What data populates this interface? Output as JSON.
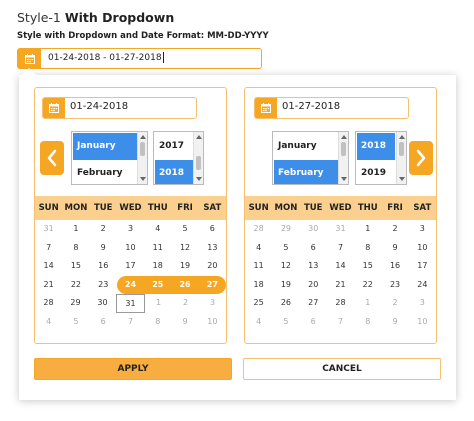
{
  "header": {
    "title_prefix": "Style-1",
    "title_bold": "With Dropdown",
    "subtitle": "Style with Dropdown and Date Format: MM-DD-YYYY"
  },
  "main_input": {
    "value": "01-24-2018 - 01-27-2018"
  },
  "left": {
    "date_value": "01-24-2018",
    "months": [
      {
        "label": "January",
        "selected": true
      },
      {
        "label": "February",
        "selected": false
      }
    ],
    "years": [
      {
        "label": "2017",
        "selected": false
      },
      {
        "label": "2018",
        "selected": true
      }
    ],
    "weekdays": [
      "SUN",
      "MON",
      "TUE",
      "WED",
      "THU",
      "FRI",
      "SAT"
    ],
    "weeks": [
      [
        {
          "d": "31",
          "s": "out"
        },
        {
          "d": "1"
        },
        {
          "d": "2"
        },
        {
          "d": "3"
        },
        {
          "d": "4"
        },
        {
          "d": "5"
        },
        {
          "d": "6"
        }
      ],
      [
        {
          "d": "7"
        },
        {
          "d": "8"
        },
        {
          "d": "9"
        },
        {
          "d": "10"
        },
        {
          "d": "11"
        },
        {
          "d": "12"
        },
        {
          "d": "13"
        }
      ],
      [
        {
          "d": "14"
        },
        {
          "d": "15"
        },
        {
          "d": "16"
        },
        {
          "d": "17"
        },
        {
          "d": "18"
        },
        {
          "d": "19"
        },
        {
          "d": "20"
        }
      ],
      [
        {
          "d": "21"
        },
        {
          "d": "22"
        },
        {
          "d": "23"
        },
        {
          "d": "24",
          "s": "range start"
        },
        {
          "d": "25",
          "s": "range"
        },
        {
          "d": "26",
          "s": "range"
        },
        {
          "d": "27",
          "s": "range end"
        }
      ],
      [
        {
          "d": "28"
        },
        {
          "d": "29"
        },
        {
          "d": "30"
        },
        {
          "d": "31",
          "s": "today"
        },
        {
          "d": "1",
          "s": "out"
        },
        {
          "d": "2",
          "s": "out"
        },
        {
          "d": "3",
          "s": "out"
        }
      ],
      [
        {
          "d": "4",
          "s": "out"
        },
        {
          "d": "5",
          "s": "out"
        },
        {
          "d": "6",
          "s": "out"
        },
        {
          "d": "7",
          "s": "out"
        },
        {
          "d": "8",
          "s": "out"
        },
        {
          "d": "9",
          "s": "out"
        },
        {
          "d": "10",
          "s": "out"
        }
      ]
    ]
  },
  "right": {
    "date_value": "01-27-2018",
    "months": [
      {
        "label": "January",
        "selected": false
      },
      {
        "label": "February",
        "selected": true
      }
    ],
    "years": [
      {
        "label": "2018",
        "selected": true
      },
      {
        "label": "2019",
        "selected": false
      }
    ],
    "weekdays": [
      "SUN",
      "MON",
      "TUE",
      "WED",
      "THU",
      "FRI",
      "SAT"
    ],
    "weeks": [
      [
        {
          "d": "28",
          "s": "out"
        },
        {
          "d": "29",
          "s": "out"
        },
        {
          "d": "30",
          "s": "out"
        },
        {
          "d": "31",
          "s": "out"
        },
        {
          "d": "1"
        },
        {
          "d": "2"
        },
        {
          "d": "3"
        }
      ],
      [
        {
          "d": "4"
        },
        {
          "d": "5"
        },
        {
          "d": "6"
        },
        {
          "d": "7"
        },
        {
          "d": "8"
        },
        {
          "d": "9"
        },
        {
          "d": "10"
        }
      ],
      [
        {
          "d": "11"
        },
        {
          "d": "12"
        },
        {
          "d": "13"
        },
        {
          "d": "14"
        },
        {
          "d": "15"
        },
        {
          "d": "16"
        },
        {
          "d": "17"
        }
      ],
      [
        {
          "d": "18"
        },
        {
          "d": "19"
        },
        {
          "d": "20"
        },
        {
          "d": "21"
        },
        {
          "d": "22"
        },
        {
          "d": "23"
        },
        {
          "d": "24"
        }
      ],
      [
        {
          "d": "25"
        },
        {
          "d": "26"
        },
        {
          "d": "27"
        },
        {
          "d": "28"
        },
        {
          "d": "1",
          "s": "out"
        },
        {
          "d": "2",
          "s": "out"
        },
        {
          "d": "3",
          "s": "out"
        }
      ],
      [
        {
          "d": "4",
          "s": "out"
        },
        {
          "d": "5",
          "s": "out"
        },
        {
          "d": "6",
          "s": "out"
        },
        {
          "d": "7",
          "s": "out"
        },
        {
          "d": "8",
          "s": "out"
        },
        {
          "d": "9",
          "s": "out"
        },
        {
          "d": "10",
          "s": "out"
        }
      ]
    ]
  },
  "icons": {
    "calendar": "calendar-icon",
    "prev": "chevron-left-icon",
    "next": "chevron-right-icon"
  },
  "buttons": {
    "apply": "APPLY",
    "cancel": "CANCEL"
  },
  "colors": {
    "accent": "#f5a623",
    "header_row": "#fbd08e",
    "select_blue": "#3d8ee8"
  }
}
